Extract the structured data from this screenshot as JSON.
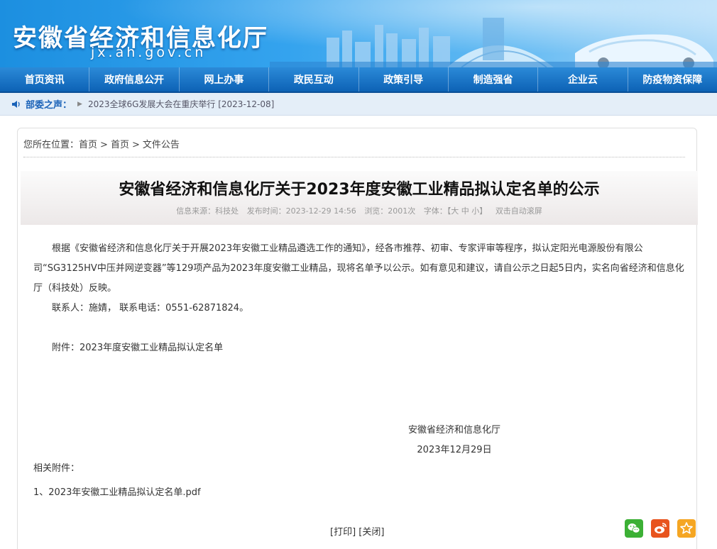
{
  "header": {
    "site_title": "安徽省经济和信息化厅",
    "site_domain": "jx.ah.gov.cn"
  },
  "nav": {
    "items": [
      "首页资讯",
      "政府信息公开",
      "网上办事",
      "政民互动",
      "政策引导",
      "制造强省",
      "企业云",
      "防疫物资保障"
    ]
  },
  "ticker": {
    "label": "部委之声：",
    "text": "2023全球6G发展大会在重庆举行 [2023-12-08]"
  },
  "breadcrumb": {
    "prefix": "您所在位置：",
    "items": [
      "首页",
      "首页",
      "文件公告"
    ]
  },
  "article": {
    "title": "安徽省经济和信息化厅关于2023年度安徽工业精品拟认定名单的公示",
    "meta": {
      "source": "信息来源：科技处",
      "time": "发布时间：2023-12-29 14:56",
      "views": "浏览：2001次",
      "font": "字体：【大 中 小】",
      "scroll": "双击自动滚屏"
    },
    "paragraph1": "根据《安徽省经济和信息化厅关于开展2023年安徽工业精品遴选工作的通知》，经各市推荐、初审、专家评审等程序，拟认定阳光电源股份有限公司“SG3125HV中压并网逆变器”等129项产品为2023年度安徽工业精品，现将名单予以公示。如有意见和建议，请自公示之日起5日内，实名向省经济和信息化厅（科技处）反映。",
    "contact": "联系人：施婧，  联系电话：0551-62871824。",
    "attachment_note": "附件：2023年度安徽工业精品拟认定名单",
    "signature_org": "安徽省经济和信息化厅",
    "signature_date": "2023年12月29日"
  },
  "attachments": {
    "label": "相关附件：",
    "items": [
      "1、2023年安徽工业精品拟认定名单.pdf"
    ]
  },
  "actions": {
    "print": "[打印]",
    "close": "[关闭]"
  },
  "share": {
    "icons": [
      "wechat-icon",
      "weibo-icon",
      "favorite-icon"
    ],
    "colors": {
      "wechat": "#3cb035",
      "weibo": "#e8541e",
      "favorite": "#f5a623"
    }
  }
}
